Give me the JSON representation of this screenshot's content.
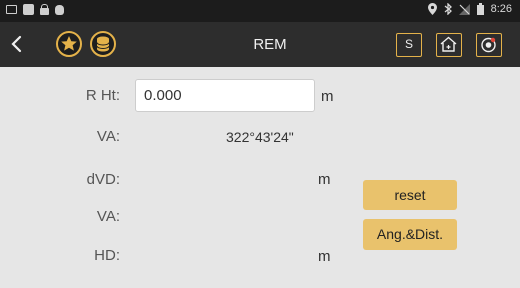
{
  "status_bar": {
    "time": "8:26",
    "left_icons": [
      "image-icon",
      "square-icon",
      "lock-icon",
      "bug-icon"
    ],
    "right_icons": [
      "location-icon",
      "bluetooth-icon",
      "no-signal-icon",
      "battery-icon"
    ]
  },
  "header": {
    "title": "REM",
    "buttons": {
      "s_label": "S"
    }
  },
  "form": {
    "r_ht": {
      "label": "R Ht:",
      "value": "0.000",
      "unit": "m"
    },
    "va1": {
      "label": "VA:",
      "value": "322°43'24\""
    },
    "dvd": {
      "label": "dVD:",
      "unit": "m"
    },
    "va2": {
      "label": "VA:"
    },
    "hd": {
      "label": "HD:",
      "unit": "m"
    }
  },
  "actions": {
    "reset_label": "reset",
    "ang_dist_label": "Ang.&Dist."
  },
  "colors": {
    "accent": "#e4b24a",
    "button_fill": "#e9c26c",
    "header_bg": "#2d2d2d",
    "status_bg": "#1c1c1c",
    "content_bg": "#e6e6e6"
  }
}
